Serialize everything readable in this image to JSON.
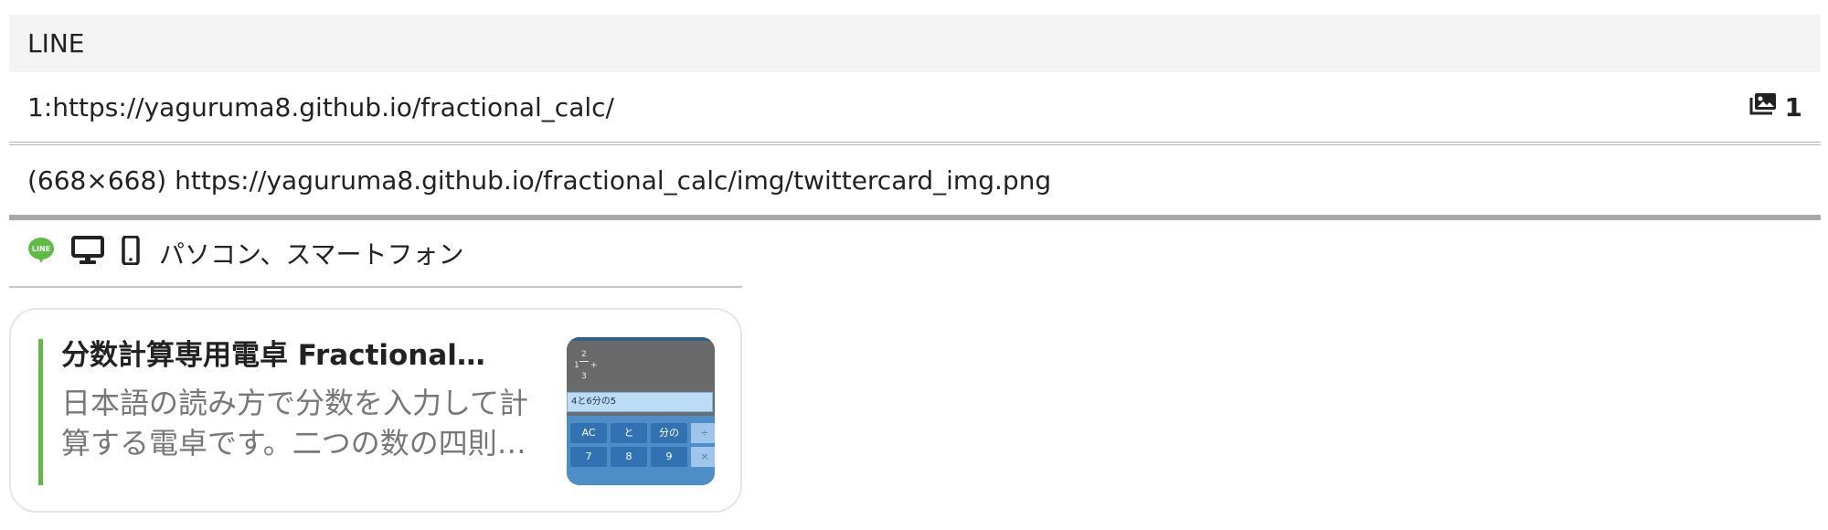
{
  "section": {
    "title": "LINE"
  },
  "url_row": {
    "url": "1:https://yaguruma8.github.io/fractional_calc/",
    "image_count": "1"
  },
  "image_row": {
    "text": "(668×668) https://yaguruma8.github.io/fractional_calc/img/twittercard_img.png"
  },
  "platform": {
    "label": "パソコン、スマートフォン",
    "colors": {
      "line": "#5dbb46"
    }
  },
  "card": {
    "title": "分数計算専用電卓 Fractional…",
    "description": "日本語の読み方で分数を入力して計算する電卓です。二つの数の四則…",
    "accent": "#5dbb46",
    "thumbnail": {
      "fraction_whole": "1",
      "fraction_num": "2",
      "fraction_den": "3",
      "operator": "+",
      "input_text": "4と6分の5",
      "keys": [
        "AC",
        "と",
        "分の",
        "7",
        "8",
        "9"
      ],
      "side_keys": [
        "÷",
        "×"
      ]
    }
  }
}
